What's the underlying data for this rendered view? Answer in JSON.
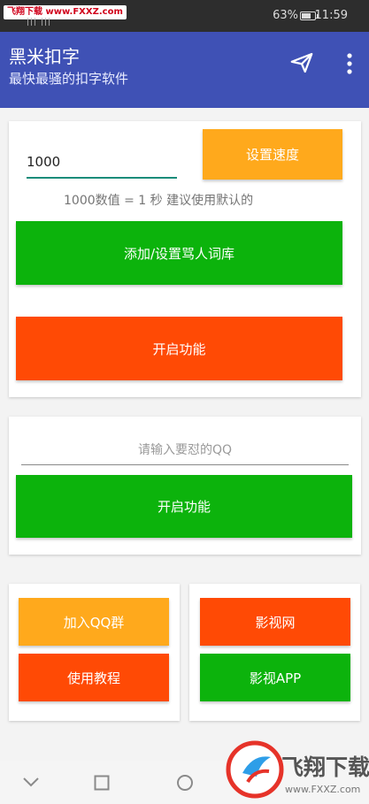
{
  "status_bar": {
    "watermark": "飞翔下载 www.FXXZ.com",
    "signal": "|||  |||",
    "battery": "63%",
    "time": "11:59"
  },
  "app_bar": {
    "title": "黑米扣字",
    "subtitle": "最快最骚的扣字软件"
  },
  "speed_card": {
    "speed_value": "1000",
    "set_speed_label": "设置速度",
    "hint": "1000数值 = 1 秒 建议使用默认的",
    "add_library_label": "添加/设置骂人词库",
    "start_label": "开启功能"
  },
  "qq_card": {
    "qq_placeholder": "请输入要怼的QQ",
    "start_label": "开启功能"
  },
  "links_left": {
    "join_group_label": "加入QQ群",
    "tutorial_label": "使用教程"
  },
  "links_right": {
    "movie_site_label": "影视网",
    "movie_app_label": "影视APP"
  },
  "logo": {
    "text": "飞翔下载",
    "url": "www.FXXZ.com"
  },
  "colors": {
    "app_bar": "#3f51b5",
    "orange": "#ffa91c",
    "green": "#0cb30c",
    "red_orange": "#ff4a05",
    "accent_line": "#1a8c7a"
  },
  "icons": {
    "send": "send-icon",
    "more": "more-vert-icon",
    "back": "chevron-down-icon",
    "recent": "square-icon",
    "home": "circle-icon"
  }
}
